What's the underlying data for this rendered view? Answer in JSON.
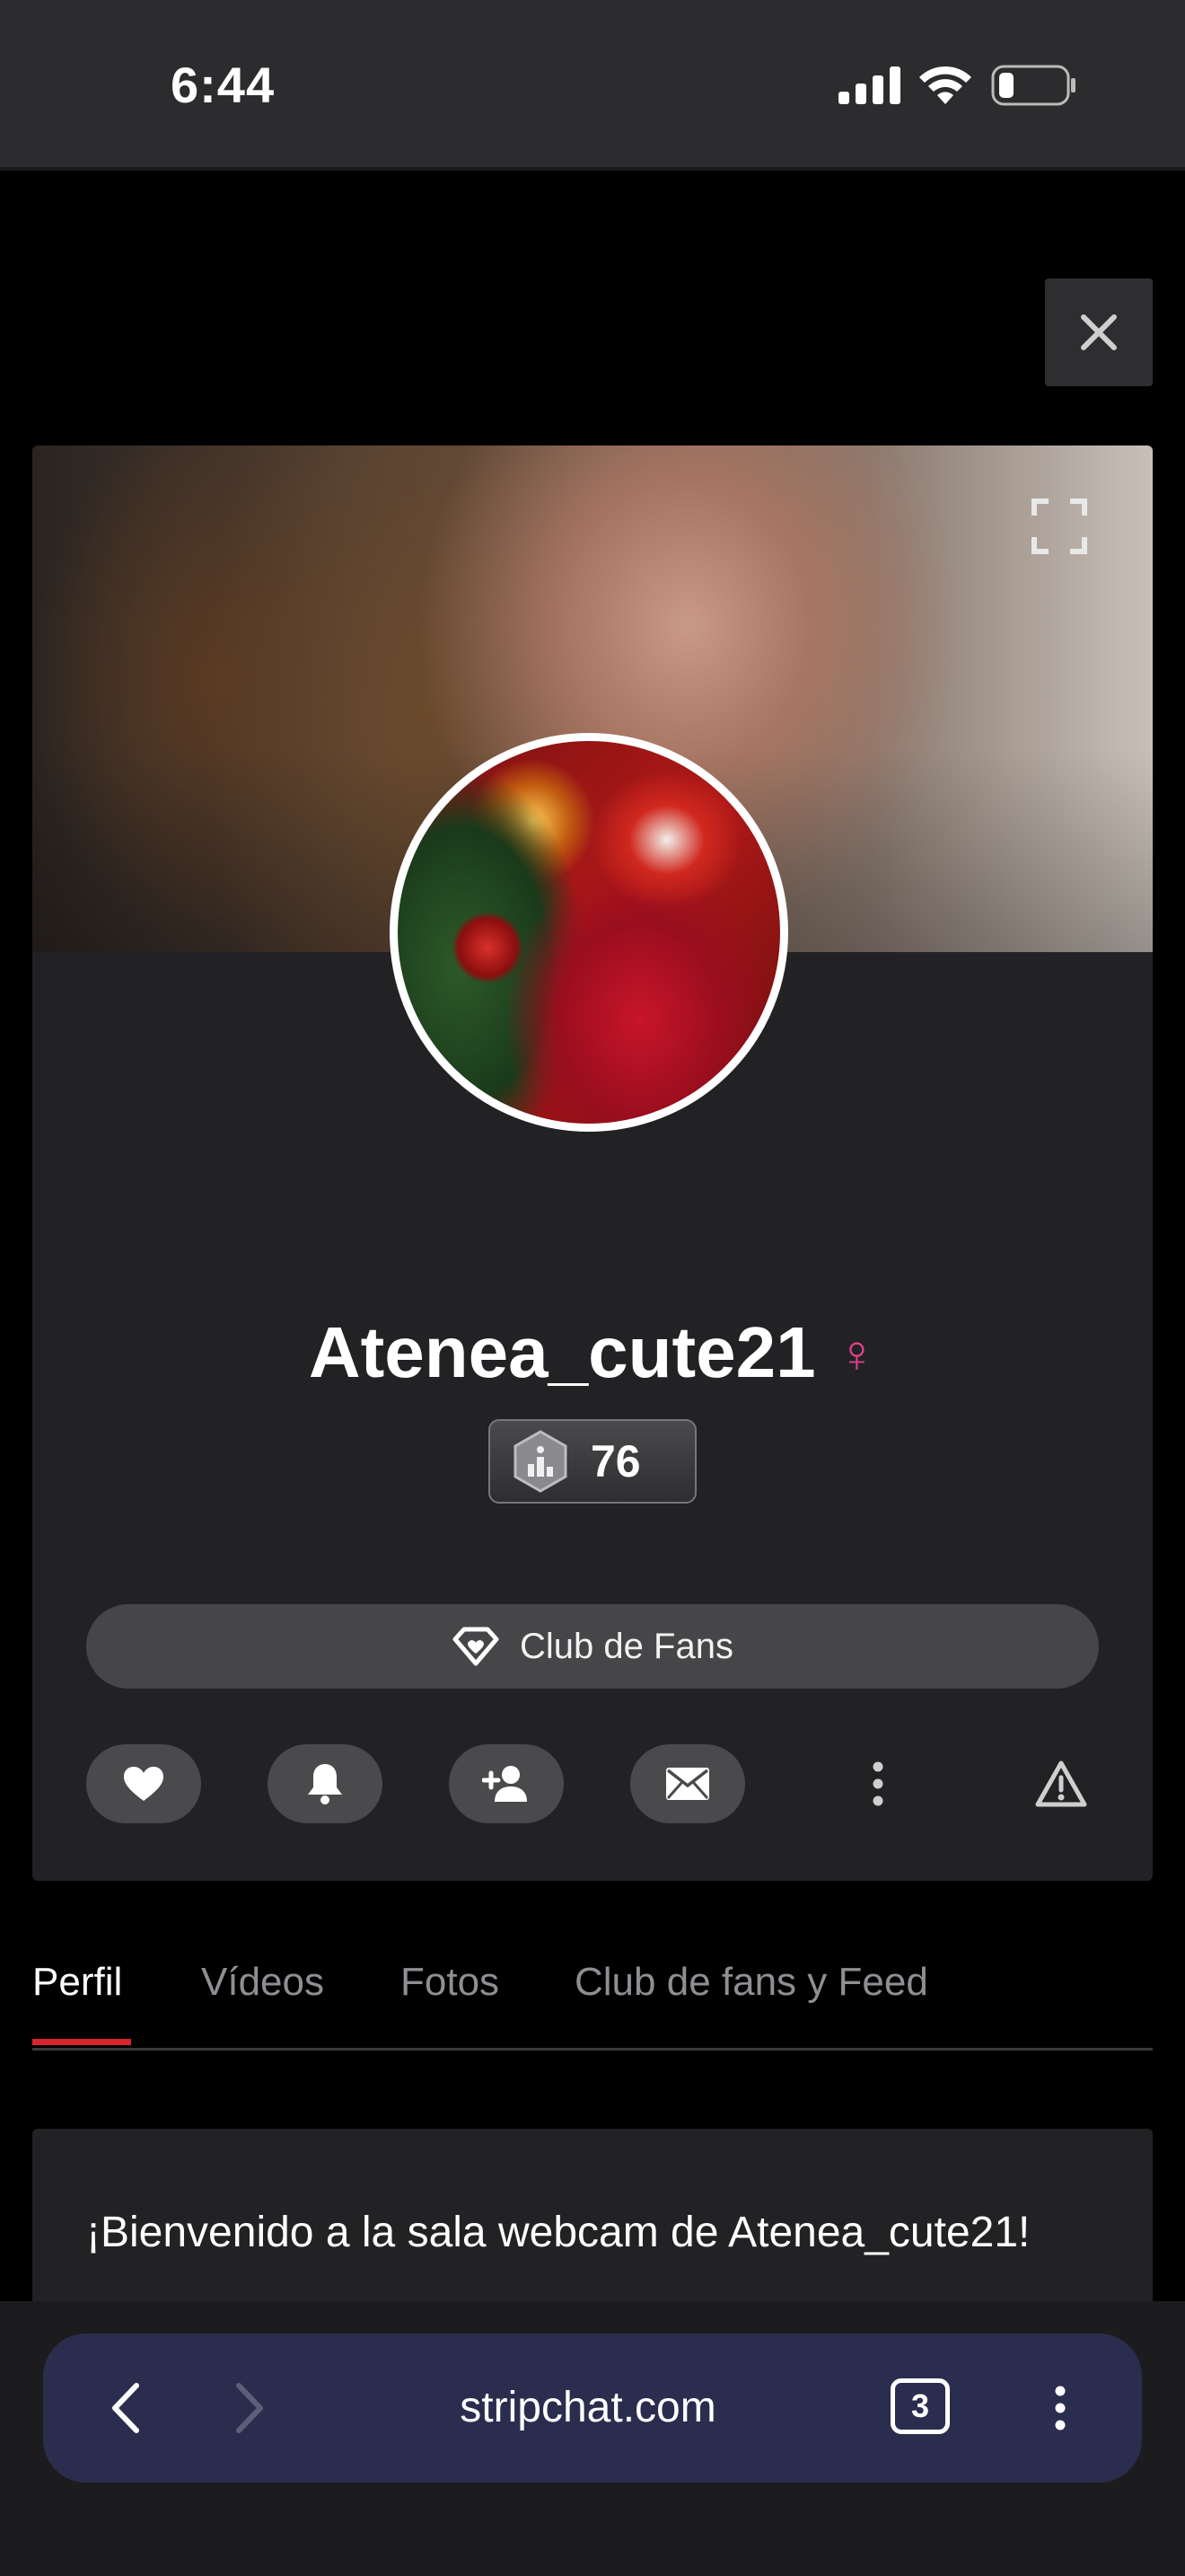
{
  "status_bar": {
    "time": "6:44",
    "icons": [
      "cellular-signal-icon",
      "wifi-icon",
      "battery-icon"
    ]
  },
  "close_icon": "close-icon",
  "profile": {
    "cover_expand_icon": "fullscreen-icon",
    "username": "Atenea_cute21",
    "gender_symbol": "♀",
    "rank_icon": "trophy-hexagon-icon",
    "rank": "76",
    "fanclub_button": {
      "label": "Club de Fans",
      "icon": "diamond-heart-icon"
    },
    "actions": [
      {
        "name": "favorite",
        "icon": "heart-icon"
      },
      {
        "name": "notifications",
        "icon": "bell-icon"
      },
      {
        "name": "follow",
        "icon": "add-user-icon"
      },
      {
        "name": "message",
        "icon": "envelope-icon"
      },
      {
        "name": "more",
        "icon": "more-vertical-icon"
      },
      {
        "name": "report",
        "icon": "warning-icon"
      }
    ]
  },
  "tabs": [
    {
      "label": "Perfil",
      "active": true
    },
    {
      "label": "Vídeos",
      "active": false
    },
    {
      "label": "Fotos",
      "active": false
    },
    {
      "label": "Club de fans y Feed",
      "active": false
    }
  ],
  "welcome": {
    "text": "¡Bienvenido a la sala webcam de Atenea_cute21!"
  },
  "browser": {
    "url": "stripchat.com",
    "tab_count": "3",
    "back_icon": "chevron-left-icon",
    "forward_icon": "chevron-right-icon",
    "menu_icon": "more-vertical-icon"
  },
  "colors": {
    "accent_tab_underline": "#d9232d",
    "gender_pink": "#e0408c",
    "url_bar": "#2b2d4e",
    "card_bg": "#222224"
  }
}
